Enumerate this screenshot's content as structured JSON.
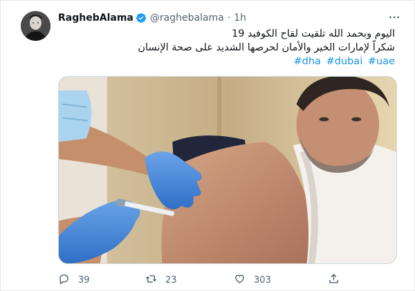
{
  "tweet": {
    "author_name": "RaghebAlama",
    "handle": "@raghebalama",
    "separator": "·",
    "time": "1h",
    "text_line_1": "اليوم وبحمد الله تلقيت لقاح الكوفيد 19",
    "text_line_2": "شكراً لإمارات الخير والأمان لحرصها الشديد على صحة الإنسان",
    "hashtags": [
      "#dha",
      "#dubai",
      "#uae"
    ]
  },
  "actions": {
    "replies": "39",
    "retweets": "23",
    "likes": "303"
  },
  "icons": {
    "verified": "verified-badge-icon",
    "more": "more-options-icon",
    "reply": "reply-icon",
    "retweet": "retweet-icon",
    "like": "heart-icon",
    "share": "share-icon"
  },
  "colors": {
    "link": "#1b95e0",
    "verified": "#1d9bf0",
    "muted": "#536471"
  }
}
